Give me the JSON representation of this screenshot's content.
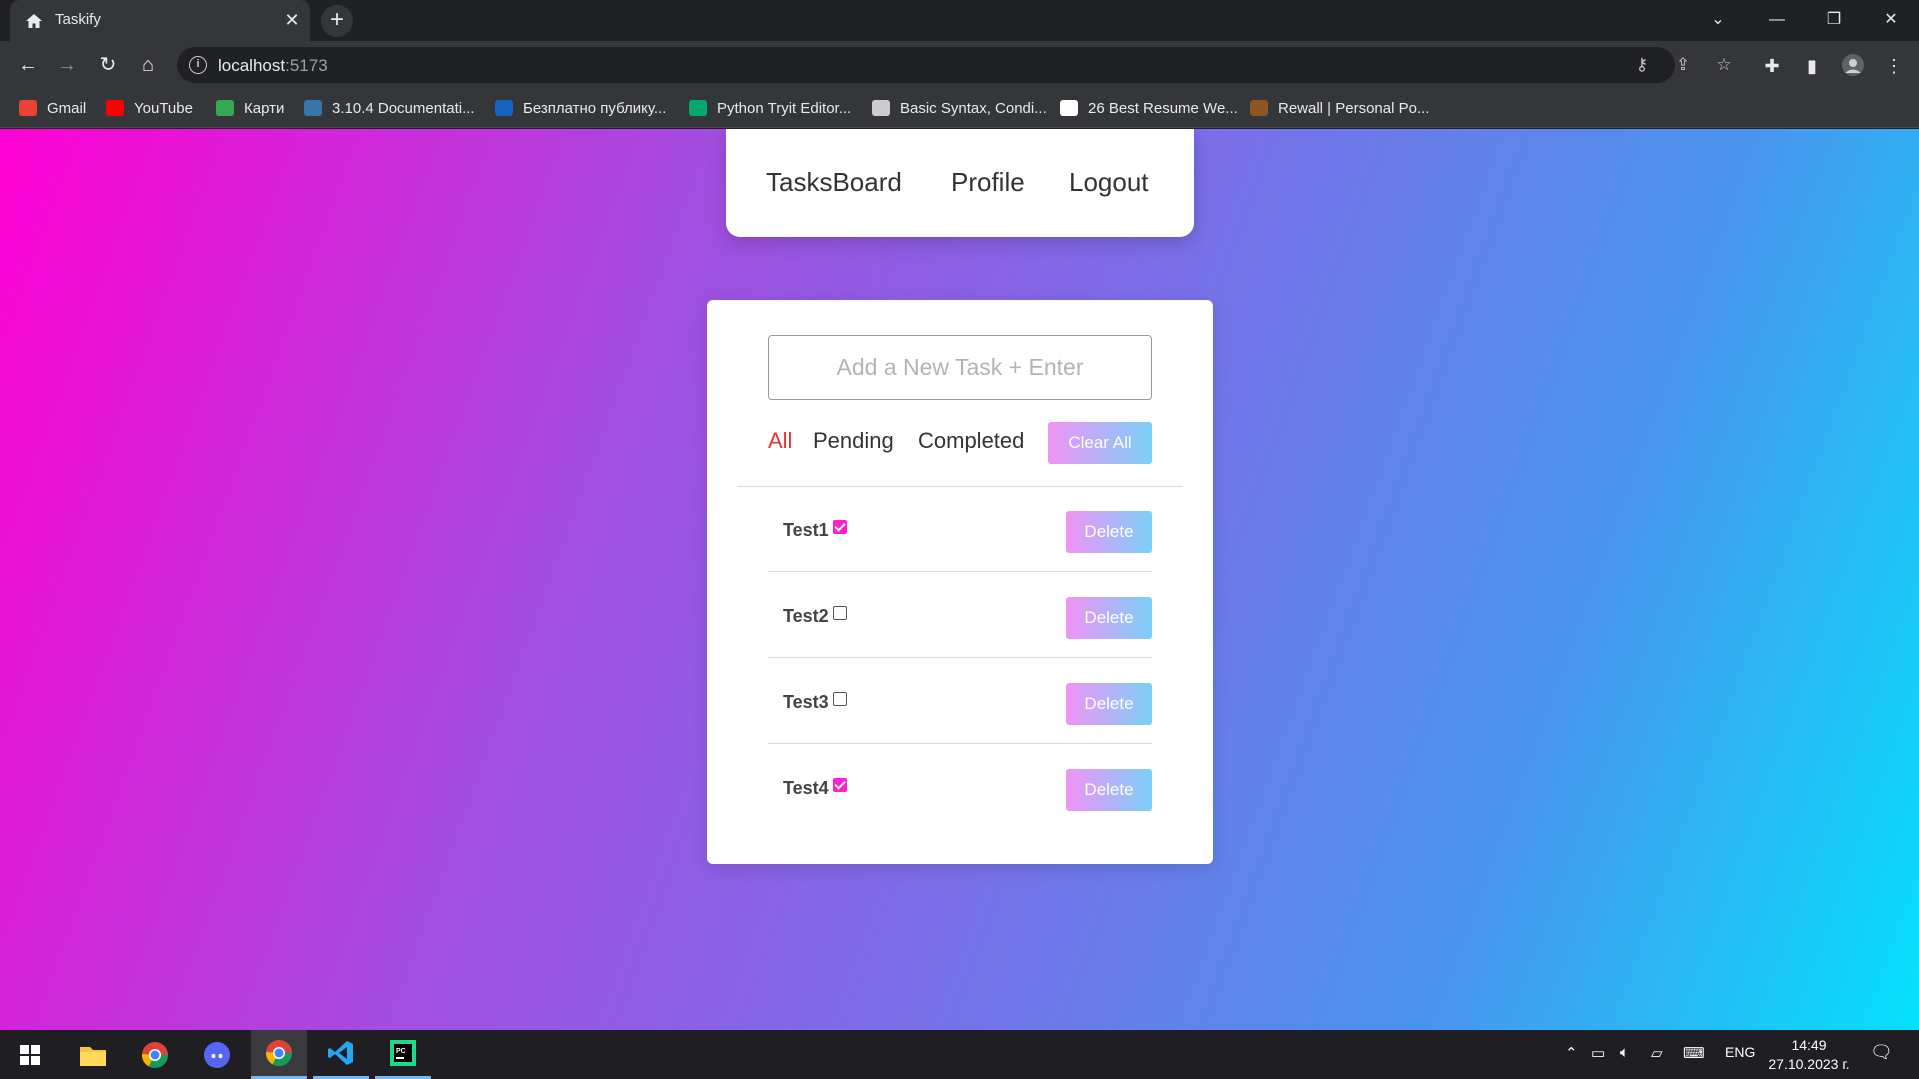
{
  "browser": {
    "tab_title": "Taskify",
    "url_host": "localhost",
    "url_port": ":5173",
    "bookmarks": [
      {
        "label": "Gmail",
        "icon": "gmail-icon",
        "color": "#ea4335"
      },
      {
        "label": "YouTube",
        "icon": "youtube-icon",
        "color": "#ff0000"
      },
      {
        "label": "Карти",
        "icon": "maps-icon",
        "color": "#34a853"
      },
      {
        "label": "3.10.4 Documentati...",
        "icon": "python-icon",
        "color": "#3776ab"
      },
      {
        "label": "Безплатно публику...",
        "icon": "site-icon",
        "color": "#1565c0"
      },
      {
        "label": "Python Tryit Editor...",
        "icon": "w3schools-icon",
        "color": "#04aa6d"
      },
      {
        "label": "Basic Syntax, Condi...",
        "icon": "site-icon",
        "color": "#cccccc"
      },
      {
        "label": "26 Best Resume We...",
        "icon": "site-icon",
        "color": "#ffffff"
      },
      {
        "label": "Rewall | Personal Po...",
        "icon": "site-icon",
        "color": "#8d5524"
      }
    ]
  },
  "app": {
    "nav": {
      "tasksboard": "TasksBoard",
      "profile": "Profile",
      "logout": "Logout"
    },
    "input_placeholder": "Add a New Task + Enter",
    "filters": {
      "all": "All",
      "pending": "Pending",
      "completed": "Completed",
      "active": "all"
    },
    "clear_all_label": "Clear All",
    "delete_label": "Delete",
    "tasks": [
      {
        "name": "Test1",
        "completed": true
      },
      {
        "name": "Test2",
        "completed": false
      },
      {
        "name": "Test3",
        "completed": false
      },
      {
        "name": "Test4",
        "completed": true
      }
    ]
  },
  "taskbar": {
    "language": "ENG",
    "time": "14:49",
    "date": "27.10.2023 г."
  },
  "colors": {
    "accent_red": "#e8332f",
    "checkbox_pink": "#ff1fd0",
    "gradient_start": "#ff00d4",
    "gradient_end": "#04e1fb"
  }
}
